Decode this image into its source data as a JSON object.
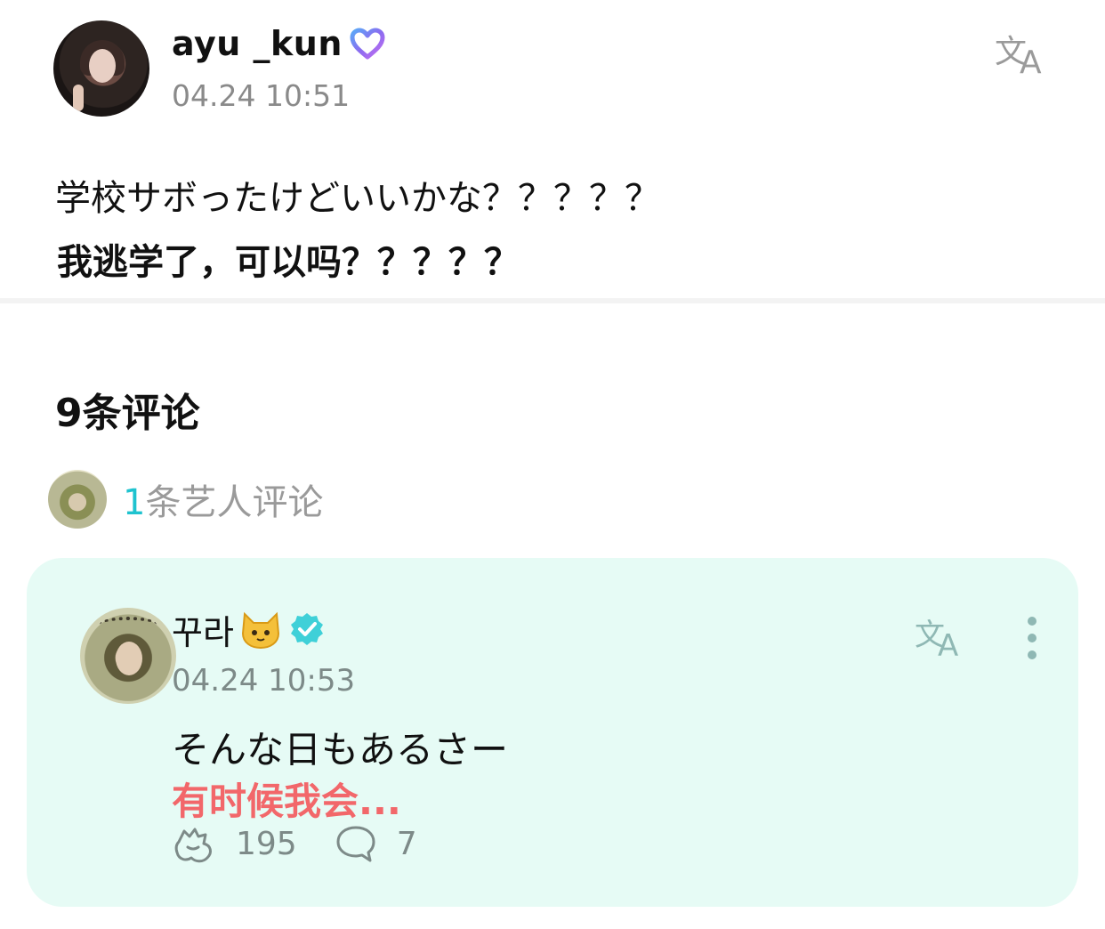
{
  "post": {
    "username": "ayu _kun",
    "time": "04.24 10:51",
    "text_original": "学校サボったけどいいかな？？？？？",
    "text_translated": "我逃学了，可以吗？？？？？"
  },
  "comments": {
    "count_label": "9条评论",
    "artist_summary": {
      "count": "1",
      "label": "条艺人评论"
    },
    "items": [
      {
        "author": "꾸라",
        "time": "04.24 10:53",
        "text_original": "そんな日もあるさー",
        "text_translated": "有时候我会...",
        "likes": "195",
        "replies": "7"
      }
    ]
  },
  "icons": {
    "translate": "translate-icon",
    "verified": "verified-badge-icon",
    "heart_badge": "heart-badge-icon",
    "more": "more-vertical-icon",
    "like": "like-icon",
    "reply": "reply-bubble-icon"
  },
  "colors": {
    "accent_teal": "#1fc3cf",
    "card_bg": "#e6fbf5",
    "translation_red": "#f2676a",
    "muted_gray": "#8a8a8a"
  }
}
